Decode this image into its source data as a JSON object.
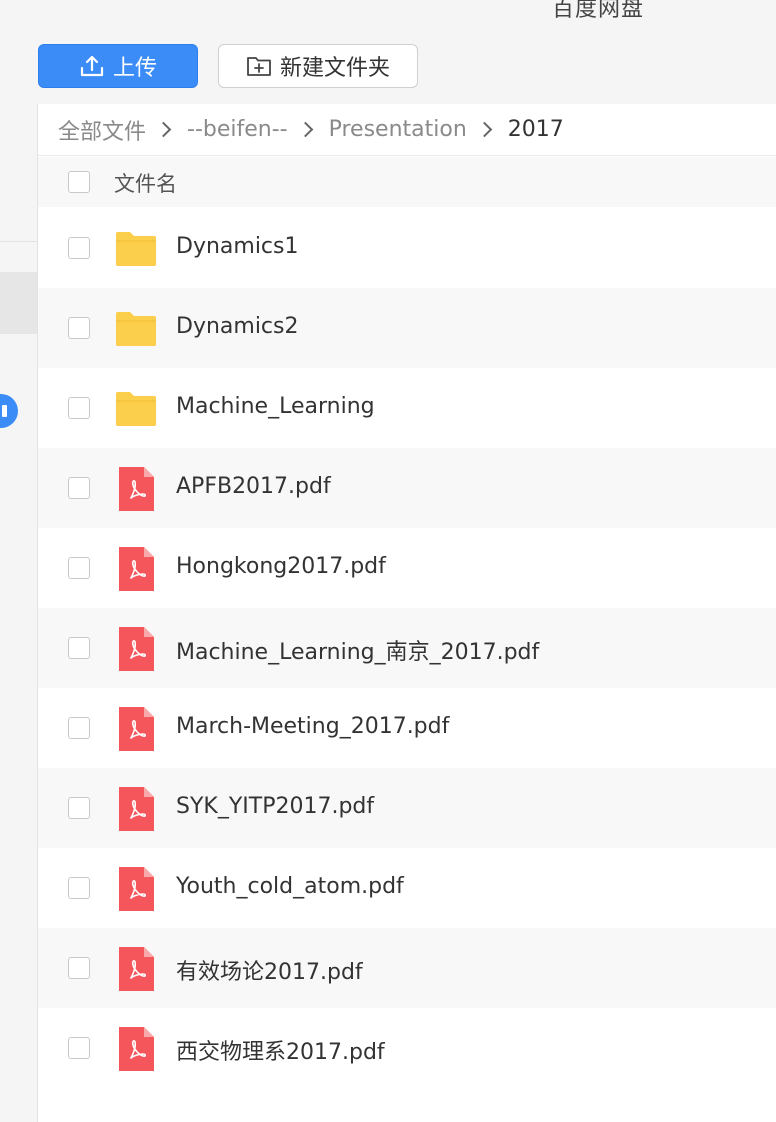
{
  "app": {
    "title": "百度网盘"
  },
  "toolbar": {
    "upload_label": "上传",
    "new_folder_label": "新建文件夹"
  },
  "colors": {
    "accent": "#3b8cf7",
    "folder": "#fbce4c",
    "pdf": "#f4565b"
  },
  "breadcrumb": {
    "items": [
      "全部文件",
      "--beifen--",
      "Presentation",
      "2017"
    ]
  },
  "file_list": {
    "header": {
      "name_label": "文件名"
    },
    "files": [
      {
        "name": "Dynamics1",
        "type": "folder",
        "icon": "folder-icon"
      },
      {
        "name": "Dynamics2",
        "type": "folder",
        "icon": "folder-icon"
      },
      {
        "name": "Machine_Learning",
        "type": "folder",
        "icon": "folder-icon"
      },
      {
        "name": "APFB2017.pdf",
        "type": "pdf",
        "icon": "pdf-icon"
      },
      {
        "name": "Hongkong2017.pdf",
        "type": "pdf",
        "icon": "pdf-icon"
      },
      {
        "name": "Machine_Learning_南京_2017.pdf",
        "type": "pdf",
        "icon": "pdf-icon"
      },
      {
        "name": "March-Meeting_2017.pdf",
        "type": "pdf",
        "icon": "pdf-icon"
      },
      {
        "name": "SYK_YITP2017.pdf",
        "type": "pdf",
        "icon": "pdf-icon"
      },
      {
        "name": "Youth_cold_atom.pdf",
        "type": "pdf",
        "icon": "pdf-icon"
      },
      {
        "name": "有效场论2017.pdf",
        "type": "pdf",
        "icon": "pdf-icon"
      },
      {
        "name": "西交物理系2017.pdf",
        "type": "pdf",
        "icon": "pdf-icon"
      }
    ]
  }
}
